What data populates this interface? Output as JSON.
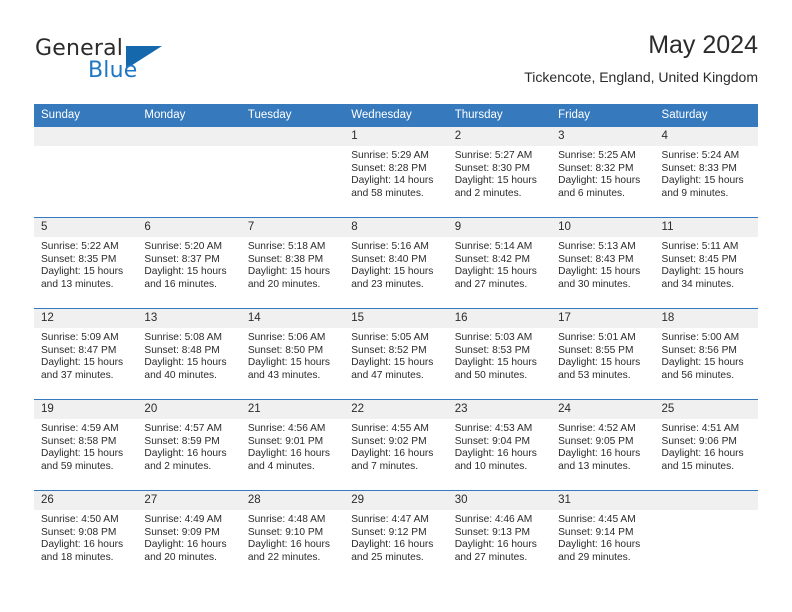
{
  "brand": {
    "name_top": "General",
    "name_bottom": "Blue",
    "accent_color": "#1f77c4",
    "triangle_color": "#1668ad"
  },
  "header": {
    "title": "May 2024",
    "location": "Tickencote, England, United Kingdom"
  },
  "theme": {
    "header_row_bg": "#3679bc",
    "header_row_text": "#ffffff",
    "daynum_band_bg": "#f0f0f0",
    "row_divider": "#3679bc",
    "text": "#2b2b2b"
  },
  "calendar": {
    "weekday_headers": [
      "Sunday",
      "Monday",
      "Tuesday",
      "Wednesday",
      "Thursday",
      "Friday",
      "Saturday"
    ],
    "labels": {
      "sunrise_prefix": "Sunrise:",
      "sunset_prefix": "Sunset:",
      "daylight_prefix": "Daylight:"
    },
    "weeks": [
      [
        {
          "day": "",
          "empty": true
        },
        {
          "day": "",
          "empty": true
        },
        {
          "day": "",
          "empty": true
        },
        {
          "day": "1",
          "sunrise": "Sunrise: 5:29 AM",
          "sunset": "Sunset: 8:28 PM",
          "daylight_line1": "Daylight: 14 hours",
          "daylight_line2": "and 58 minutes."
        },
        {
          "day": "2",
          "sunrise": "Sunrise: 5:27 AM",
          "sunset": "Sunset: 8:30 PM",
          "daylight_line1": "Daylight: 15 hours",
          "daylight_line2": "and 2 minutes."
        },
        {
          "day": "3",
          "sunrise": "Sunrise: 5:25 AM",
          "sunset": "Sunset: 8:32 PM",
          "daylight_line1": "Daylight: 15 hours",
          "daylight_line2": "and 6 minutes."
        },
        {
          "day": "4",
          "sunrise": "Sunrise: 5:24 AM",
          "sunset": "Sunset: 8:33 PM",
          "daylight_line1": "Daylight: 15 hours",
          "daylight_line2": "and 9 minutes."
        }
      ],
      [
        {
          "day": "5",
          "sunrise": "Sunrise: 5:22 AM",
          "sunset": "Sunset: 8:35 PM",
          "daylight_line1": "Daylight: 15 hours",
          "daylight_line2": "and 13 minutes."
        },
        {
          "day": "6",
          "sunrise": "Sunrise: 5:20 AM",
          "sunset": "Sunset: 8:37 PM",
          "daylight_line1": "Daylight: 15 hours",
          "daylight_line2": "and 16 minutes."
        },
        {
          "day": "7",
          "sunrise": "Sunrise: 5:18 AM",
          "sunset": "Sunset: 8:38 PM",
          "daylight_line1": "Daylight: 15 hours",
          "daylight_line2": "and 20 minutes."
        },
        {
          "day": "8",
          "sunrise": "Sunrise: 5:16 AM",
          "sunset": "Sunset: 8:40 PM",
          "daylight_line1": "Daylight: 15 hours",
          "daylight_line2": "and 23 minutes."
        },
        {
          "day": "9",
          "sunrise": "Sunrise: 5:14 AM",
          "sunset": "Sunset: 8:42 PM",
          "daylight_line1": "Daylight: 15 hours",
          "daylight_line2": "and 27 minutes."
        },
        {
          "day": "10",
          "sunrise": "Sunrise: 5:13 AM",
          "sunset": "Sunset: 8:43 PM",
          "daylight_line1": "Daylight: 15 hours",
          "daylight_line2": "and 30 minutes."
        },
        {
          "day": "11",
          "sunrise": "Sunrise: 5:11 AM",
          "sunset": "Sunset: 8:45 PM",
          "daylight_line1": "Daylight: 15 hours",
          "daylight_line2": "and 34 minutes."
        }
      ],
      [
        {
          "day": "12",
          "sunrise": "Sunrise: 5:09 AM",
          "sunset": "Sunset: 8:47 PM",
          "daylight_line1": "Daylight: 15 hours",
          "daylight_line2": "and 37 minutes."
        },
        {
          "day": "13",
          "sunrise": "Sunrise: 5:08 AM",
          "sunset": "Sunset: 8:48 PM",
          "daylight_line1": "Daylight: 15 hours",
          "daylight_line2": "and 40 minutes."
        },
        {
          "day": "14",
          "sunrise": "Sunrise: 5:06 AM",
          "sunset": "Sunset: 8:50 PM",
          "daylight_line1": "Daylight: 15 hours",
          "daylight_line2": "and 43 minutes."
        },
        {
          "day": "15",
          "sunrise": "Sunrise: 5:05 AM",
          "sunset": "Sunset: 8:52 PM",
          "daylight_line1": "Daylight: 15 hours",
          "daylight_line2": "and 47 minutes."
        },
        {
          "day": "16",
          "sunrise": "Sunrise: 5:03 AM",
          "sunset": "Sunset: 8:53 PM",
          "daylight_line1": "Daylight: 15 hours",
          "daylight_line2": "and 50 minutes."
        },
        {
          "day": "17",
          "sunrise": "Sunrise: 5:01 AM",
          "sunset": "Sunset: 8:55 PM",
          "daylight_line1": "Daylight: 15 hours",
          "daylight_line2": "and 53 minutes."
        },
        {
          "day": "18",
          "sunrise": "Sunrise: 5:00 AM",
          "sunset": "Sunset: 8:56 PM",
          "daylight_line1": "Daylight: 15 hours",
          "daylight_line2": "and 56 minutes."
        }
      ],
      [
        {
          "day": "19",
          "sunrise": "Sunrise: 4:59 AM",
          "sunset": "Sunset: 8:58 PM",
          "daylight_line1": "Daylight: 15 hours",
          "daylight_line2": "and 59 minutes."
        },
        {
          "day": "20",
          "sunrise": "Sunrise: 4:57 AM",
          "sunset": "Sunset: 8:59 PM",
          "daylight_line1": "Daylight: 16 hours",
          "daylight_line2": "and 2 minutes."
        },
        {
          "day": "21",
          "sunrise": "Sunrise: 4:56 AM",
          "sunset": "Sunset: 9:01 PM",
          "daylight_line1": "Daylight: 16 hours",
          "daylight_line2": "and 4 minutes."
        },
        {
          "day": "22",
          "sunrise": "Sunrise: 4:55 AM",
          "sunset": "Sunset: 9:02 PM",
          "daylight_line1": "Daylight: 16 hours",
          "daylight_line2": "and 7 minutes."
        },
        {
          "day": "23",
          "sunrise": "Sunrise: 4:53 AM",
          "sunset": "Sunset: 9:04 PM",
          "daylight_line1": "Daylight: 16 hours",
          "daylight_line2": "and 10 minutes."
        },
        {
          "day": "24",
          "sunrise": "Sunrise: 4:52 AM",
          "sunset": "Sunset: 9:05 PM",
          "daylight_line1": "Daylight: 16 hours",
          "daylight_line2": "and 13 minutes."
        },
        {
          "day": "25",
          "sunrise": "Sunrise: 4:51 AM",
          "sunset": "Sunset: 9:06 PM",
          "daylight_line1": "Daylight: 16 hours",
          "daylight_line2": "and 15 minutes."
        }
      ],
      [
        {
          "day": "26",
          "sunrise": "Sunrise: 4:50 AM",
          "sunset": "Sunset: 9:08 PM",
          "daylight_line1": "Daylight: 16 hours",
          "daylight_line2": "and 18 minutes."
        },
        {
          "day": "27",
          "sunrise": "Sunrise: 4:49 AM",
          "sunset": "Sunset: 9:09 PM",
          "daylight_line1": "Daylight: 16 hours",
          "daylight_line2": "and 20 minutes."
        },
        {
          "day": "28",
          "sunrise": "Sunrise: 4:48 AM",
          "sunset": "Sunset: 9:10 PM",
          "daylight_line1": "Daylight: 16 hours",
          "daylight_line2": "and 22 minutes."
        },
        {
          "day": "29",
          "sunrise": "Sunrise: 4:47 AM",
          "sunset": "Sunset: 9:12 PM",
          "daylight_line1": "Daylight: 16 hours",
          "daylight_line2": "and 25 minutes."
        },
        {
          "day": "30",
          "sunrise": "Sunrise: 4:46 AM",
          "sunset": "Sunset: 9:13 PM",
          "daylight_line1": "Daylight: 16 hours",
          "daylight_line2": "and 27 minutes."
        },
        {
          "day": "31",
          "sunrise": "Sunrise: 4:45 AM",
          "sunset": "Sunset: 9:14 PM",
          "daylight_line1": "Daylight: 16 hours",
          "daylight_line2": "and 29 minutes."
        },
        {
          "day": "",
          "empty": true
        }
      ]
    ]
  }
}
